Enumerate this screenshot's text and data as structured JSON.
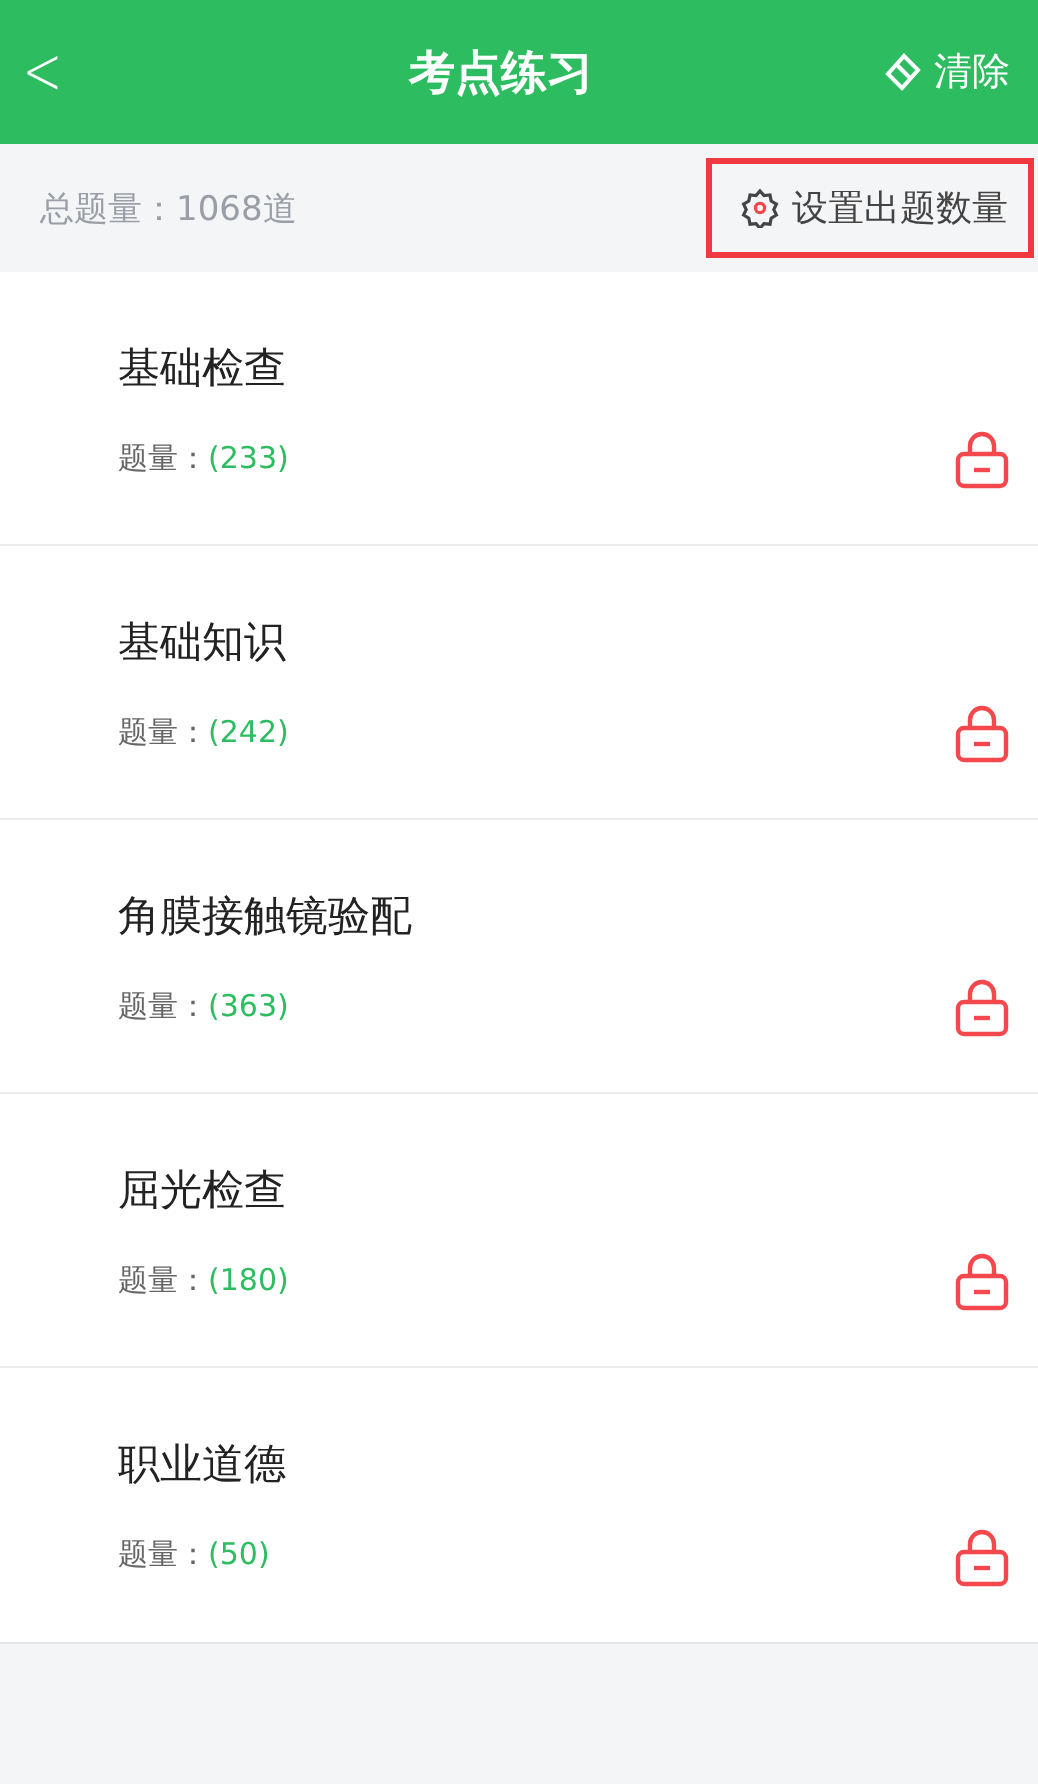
{
  "header": {
    "back": "<",
    "title": "考点练习",
    "clear_label": "清除"
  },
  "summary": {
    "total": "总题量：1068道",
    "settings_label": "设置出题数量",
    "highlighted": true
  },
  "topics": [
    {
      "name": "基础检查",
      "count_label": "题量：",
      "count": "(233)",
      "locked": true
    },
    {
      "name": "基础知识",
      "count_label": "题量：",
      "count": "(242)",
      "locked": true
    },
    {
      "name": "角膜接触镜验配",
      "count_label": "题量：",
      "count": "(363)",
      "locked": true
    },
    {
      "name": "屈光检查",
      "count_label": "题量：",
      "count": "(180)",
      "locked": true
    },
    {
      "name": "职业道德",
      "count_label": "题量：",
      "count": "(50)",
      "locked": true
    }
  ]
}
